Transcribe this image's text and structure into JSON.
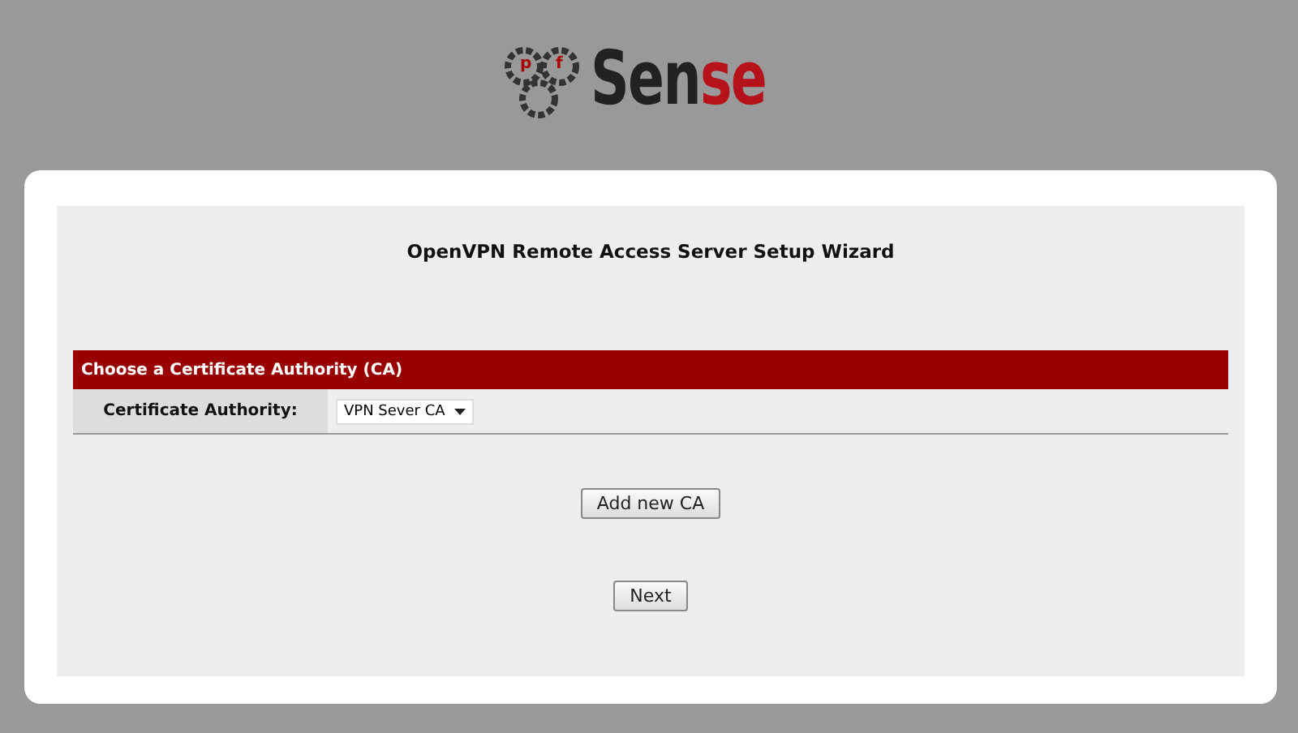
{
  "logo": {
    "gear_letters": [
      "p",
      "f"
    ],
    "word": "Sen",
    "accent": "se"
  },
  "wizard": {
    "title": "OpenVPN Remote Access Server Setup Wizard",
    "section": "Choose a Certificate Authority (CA)",
    "fields": [
      {
        "label": "Certificate Authority:",
        "value": "VPN Sever CA"
      }
    ],
    "add_button": "Add new CA",
    "next_button": "Next"
  }
}
